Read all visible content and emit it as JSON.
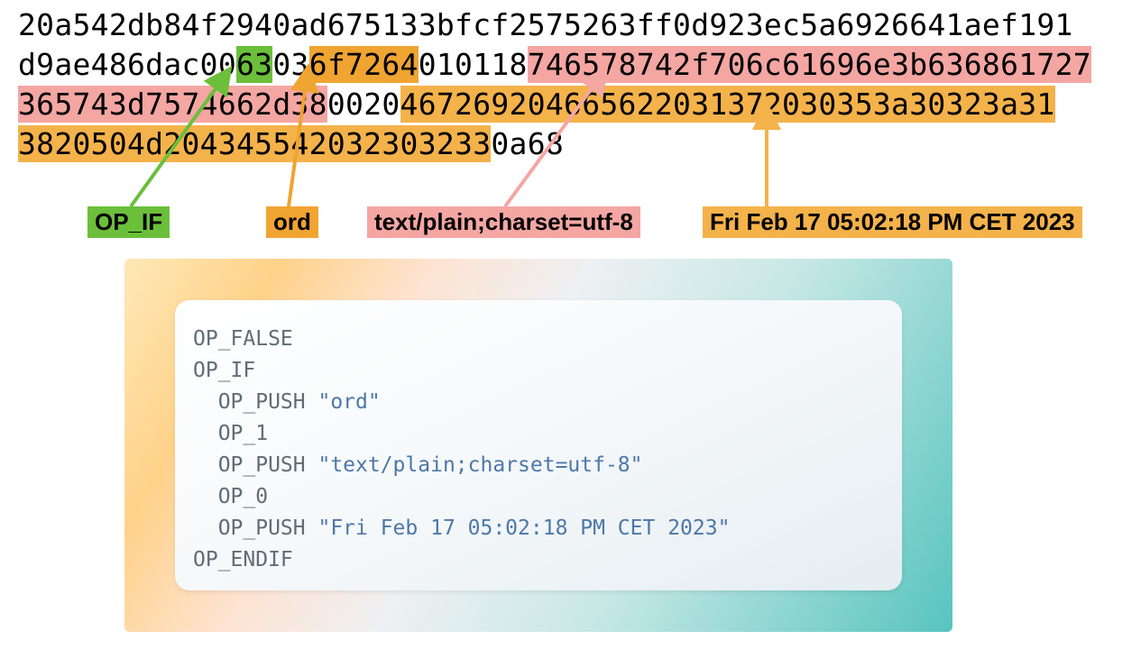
{
  "hex": {
    "l1a": "20a542db84f2940ad675133bfcf2575263ff0d923ec5a6926641aef191",
    "l2a": "d9ae486dac00",
    "l2b": "63",
    "l2c": "03",
    "l2d": "6f7264",
    "l2e": "010118",
    "l2f": "746578742f706c61696e3b636861727",
    "l3a": "365743d7574662d38",
    "l3b": "0020",
    "l3c": "467269204665622031372030353a30323a31",
    "l4a": "3820504d204345542032303233",
    "l4b": "0a68"
  },
  "labels": {
    "opif": "OP_IF",
    "ord": "ord",
    "mime": "text/plain;charset=utf-8",
    "date": "Fri Feb 17 05:02:18 PM CET 2023"
  },
  "script": {
    "l1": "OP_FALSE",
    "l2": "OP_IF",
    "l3a": "OP_PUSH ",
    "l3b": "\"ord\"",
    "l4": "OP_1",
    "l5a": "OP_PUSH ",
    "l5b": "\"text/plain;charset=utf-8\"",
    "l6": "OP_0",
    "l7a": "OP_PUSH ",
    "l7b": "\"Fri Feb 17 05:02:18 PM CET 2023\"",
    "l8": "OP_ENDIF"
  }
}
